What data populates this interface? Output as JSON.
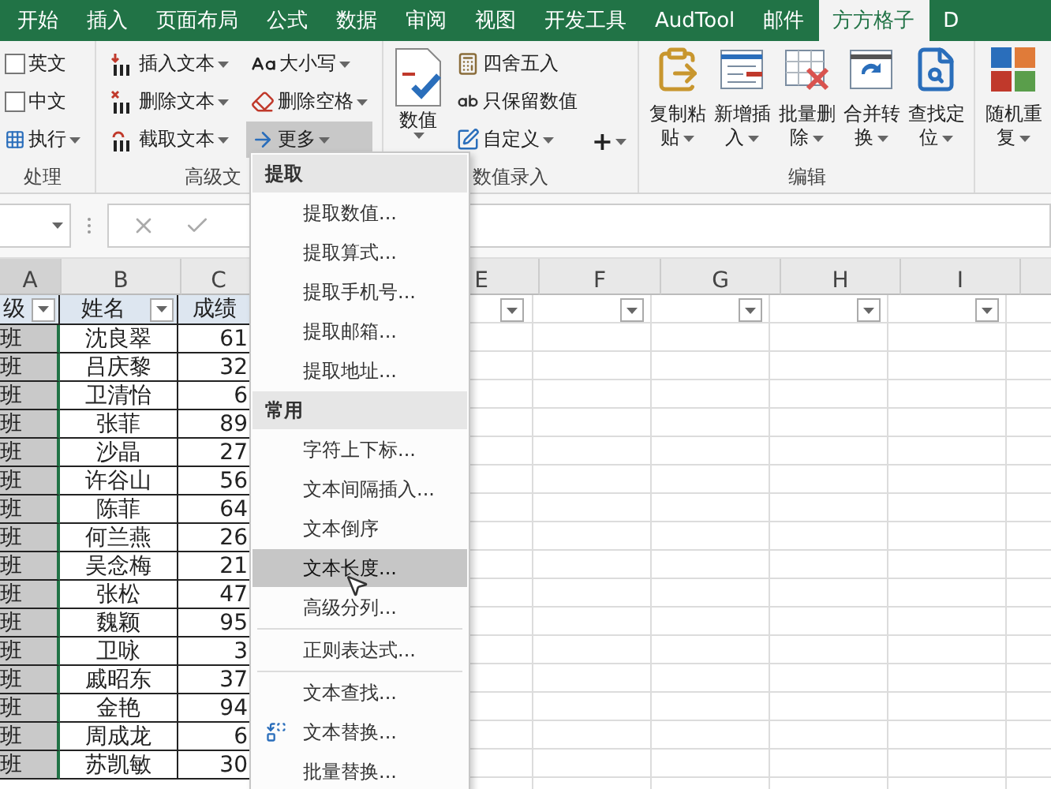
{
  "tabs": [
    {
      "label": "开始",
      "selected": false
    },
    {
      "label": "插入",
      "selected": false
    },
    {
      "label": "页面布局",
      "selected": false
    },
    {
      "label": "公式",
      "selected": false
    },
    {
      "label": "数据",
      "selected": false
    },
    {
      "label": "审阅",
      "selected": false
    },
    {
      "label": "视图",
      "selected": false
    },
    {
      "label": "开发工具",
      "selected": false
    },
    {
      "label": "AudTool",
      "selected": false
    },
    {
      "label": "邮件",
      "selected": false
    },
    {
      "label": "方方格子",
      "selected": true
    },
    {
      "label": "D",
      "selected": false
    }
  ],
  "ribbon": {
    "groups": [
      {
        "kind": "checklist",
        "label": "处理",
        "items": [
          {
            "kind": "checkbox",
            "label": "英文",
            "checked": false
          },
          {
            "kind": "checkbox",
            "label": "中文",
            "checked": false
          },
          {
            "kind": "button",
            "label": "执行",
            "dropdown": true
          }
        ]
      },
      {
        "kind": "columns",
        "label": "高级文",
        "columns": [
          [
            {
              "label": "插入文本",
              "dropdown": true,
              "pressed": false
            },
            {
              "label": "删除文本",
              "dropdown": true,
              "pressed": false
            },
            {
              "label": "截取文本",
              "dropdown": true,
              "pressed": false
            }
          ],
          [
            {
              "label": "大小写",
              "dropdown": true,
              "pressed": false
            },
            {
              "label": "删除空格",
              "dropdown": true,
              "pressed": false
            },
            {
              "label": "更多",
              "dropdown": true,
              "pressed": true
            }
          ]
        ]
      },
      {
        "kind": "numeric",
        "label": "数值录入",
        "big": {
          "label": "数值",
          "dropdown": true
        },
        "columns": [
          [
            {
              "label": "四舍五入",
              "dropdown": false,
              "pressed": false
            },
            {
              "label": "只保留数值",
              "dropdown": false,
              "pressed": false
            },
            {
              "label": "自定义",
              "dropdown": true,
              "pressed": false
            }
          ],
          [
            {
              "label": "+",
              "dropdown": true,
              "pressed": false
            }
          ]
        ]
      },
      {
        "kind": "large",
        "label": "编辑",
        "buttons": [
          {
            "lines": [
              "复制粘",
              "贴"
            ],
            "dropdown": true
          },
          {
            "lines": [
              "新增插",
              "入"
            ],
            "dropdown": true
          },
          {
            "lines": [
              "批量删",
              "除"
            ],
            "dropdown": true
          },
          {
            "lines": [
              "合并转",
              "换"
            ],
            "dropdown": true
          },
          {
            "lines": [
              "查找定",
              "位"
            ],
            "dropdown": true
          }
        ]
      },
      {
        "kind": "large",
        "buttons": [
          {
            "lines": [
              "随机重",
              "复"
            ],
            "dropdown": true
          }
        ]
      }
    ]
  },
  "sheet": {
    "columns": [
      {
        "label": "A",
        "selected": true
      },
      {
        "label": "B",
        "selected": false
      },
      {
        "label": "C",
        "selected": false
      },
      {
        "label": "E",
        "selected": false
      },
      {
        "label": "F",
        "selected": false
      },
      {
        "label": "G",
        "selected": false
      },
      {
        "label": "H",
        "selected": false
      },
      {
        "label": "I",
        "selected": false
      }
    ],
    "header_row": [
      {
        "text": "级",
        "filter": true
      },
      {
        "text": "姓名",
        "filter": true
      },
      {
        "text": "成绩",
        "filter": false
      },
      {
        "filter": true
      },
      {
        "filter": true
      },
      {
        "filter": true
      },
      {
        "filter": true
      },
      {
        "filter": true
      }
    ],
    "rows": [
      {
        "class": "班",
        "name": "沈良翠",
        "score": "61"
      },
      {
        "class": "班",
        "name": "吕庆黎",
        "score": "32"
      },
      {
        "class": "班",
        "name": "卫清怡",
        "score": "6"
      },
      {
        "class": "班",
        "name": "张菲",
        "score": "89"
      },
      {
        "class": "班",
        "name": "沙晶",
        "score": "27"
      },
      {
        "class": "班",
        "name": "许谷山",
        "score": "56"
      },
      {
        "class": "班",
        "name": "陈菲",
        "score": "64"
      },
      {
        "class": "班",
        "name": "何兰燕",
        "score": "26"
      },
      {
        "class": "班",
        "name": "吴念梅",
        "score": "21"
      },
      {
        "class": "班",
        "name": "张松",
        "score": "47"
      },
      {
        "class": "班",
        "name": "魏颖",
        "score": "95"
      },
      {
        "class": "班",
        "name": "卫咏",
        "score": "3"
      },
      {
        "class": "班",
        "name": "戚昭东",
        "score": "37"
      },
      {
        "class": "班",
        "name": "金艳",
        "score": "94"
      },
      {
        "class": "班",
        "name": "周成龙",
        "score": "6"
      },
      {
        "class": "班",
        "name": "苏凯敏",
        "score": "30"
      }
    ]
  },
  "menu": {
    "items": [
      {
        "kind": "header",
        "label": "提取"
      },
      {
        "kind": "item",
        "label": "提取数值...",
        "selected": false,
        "icon": false
      },
      {
        "kind": "item",
        "label": "提取算式...",
        "selected": false,
        "icon": false
      },
      {
        "kind": "item",
        "label": "提取手机号...",
        "selected": false,
        "icon": false
      },
      {
        "kind": "item",
        "label": "提取邮箱...",
        "selected": false,
        "icon": false
      },
      {
        "kind": "item",
        "label": "提取地址...",
        "selected": false,
        "icon": false
      },
      {
        "kind": "header",
        "label": "常用"
      },
      {
        "kind": "item",
        "label": "字符上下标...",
        "selected": false,
        "icon": false
      },
      {
        "kind": "item",
        "label": "文本间隔插入...",
        "selected": false,
        "icon": false
      },
      {
        "kind": "item",
        "label": "文本倒序",
        "selected": false,
        "icon": false
      },
      {
        "kind": "item",
        "label": "文本长度...",
        "selected": true,
        "icon": false
      },
      {
        "kind": "item",
        "label": "高级分列...",
        "selected": false,
        "icon": false
      },
      {
        "kind": "separator"
      },
      {
        "kind": "item",
        "label": "正则表达式...",
        "selected": false,
        "icon": false
      },
      {
        "kind": "separator"
      },
      {
        "kind": "item",
        "label": "文本查找...",
        "selected": false,
        "icon": false
      },
      {
        "kind": "item",
        "label": "文本替换...",
        "selected": false,
        "icon": true
      },
      {
        "kind": "item",
        "label": "批量替换...",
        "selected": false,
        "icon": false
      }
    ]
  }
}
